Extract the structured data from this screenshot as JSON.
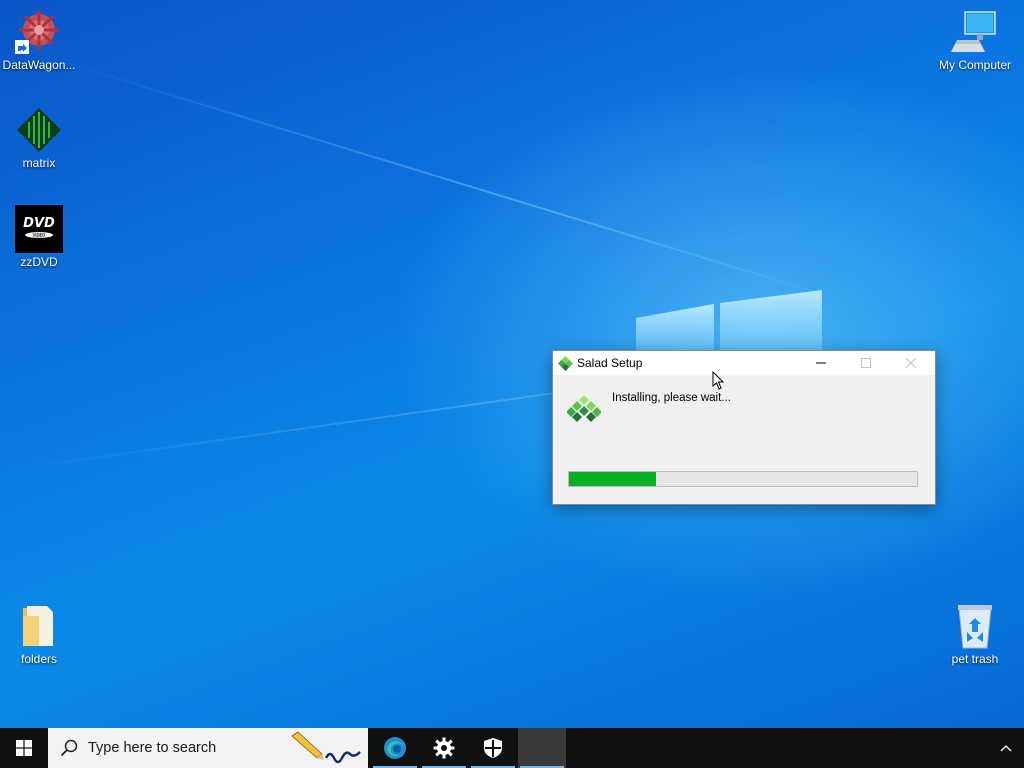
{
  "desktop": {
    "icons": [
      {
        "label": "DataWagon...",
        "icon": "datawagon-icon"
      },
      {
        "label": "matrix",
        "icon": "matrix-icon"
      },
      {
        "label": "zzDVD",
        "icon": "dvd-icon"
      },
      {
        "label": "folders",
        "icon": "folder-icon"
      },
      {
        "label": "My Computer",
        "icon": "computer-icon"
      },
      {
        "label": "pet trash",
        "icon": "recycle-bin-icon"
      }
    ]
  },
  "dialog": {
    "title": "Salad Setup",
    "status": "Installing, please wait...",
    "progress": 0.25,
    "progress_color": "#06b025"
  },
  "taskbar": {
    "search_placeholder": "Type here to search",
    "apps": [
      {
        "name": "edge-icon"
      },
      {
        "name": "settings-icon"
      },
      {
        "name": "security-icon"
      },
      {
        "name": "active-app"
      }
    ]
  },
  "colors": {
    "accent": "#0078d7",
    "taskbar": "#101010"
  }
}
